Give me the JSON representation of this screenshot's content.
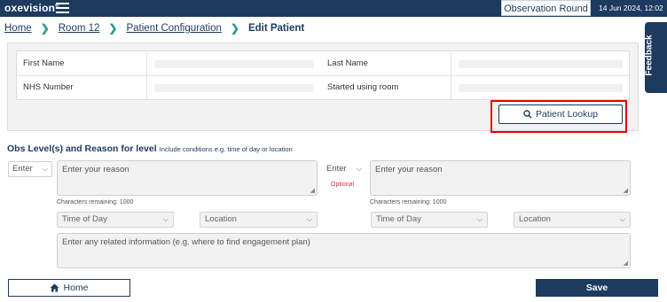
{
  "header": {
    "logo": "oxevision",
    "logo_mark": "®",
    "observation_round": "Observation Round",
    "datetime": "14 Jun 2024, 12:02"
  },
  "breadcrumb": [
    "Home",
    "Room 12",
    "Patient Configuration",
    "Edit Patient"
  ],
  "feedback_label": "Feedback",
  "patient": {
    "first_name_label": "First Name",
    "last_name_label": "Last Name",
    "nhs_number_label": "NHS Number",
    "started_using_room_label": "Started using room",
    "first_name_value": "",
    "last_name_value": "",
    "nhs_number_value": "",
    "started_using_room_value": ""
  },
  "lookup_button": "Patient Lookup",
  "obs": {
    "title": "Obs Level(s) and Reason for level",
    "hint": "Include conditions e.g. time of day or location",
    "level1": "Enter",
    "level2": "Enter",
    "reason_placeholder": "Enter your reason",
    "chars_remaining": "Characters remaining: 1000",
    "optional": "Optional",
    "time_of_day": "Time of Day",
    "location": "Location",
    "related_info_placeholder": "Enter any related information (e.g. where to find engagement plan)"
  },
  "footer": {
    "home": "Home",
    "save": "Save"
  },
  "colors": {
    "navy": "#1d3a5f",
    "teal_chevron": "#2e9b8f",
    "highlight_red": "#e60000",
    "optional_red": "#dd3333"
  },
  "icons": [
    "menu-icon",
    "chevron-right-icon",
    "search-icon",
    "home-icon",
    "chevron-down-icon",
    "resize-grip-icon"
  ]
}
